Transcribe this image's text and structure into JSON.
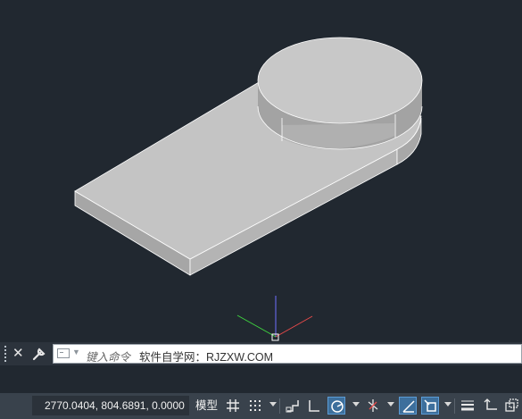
{
  "viewport": {
    "background": "#212830",
    "model": {
      "description_icon": "3d-solid-model",
      "colors": {
        "top": "#c3c3c3",
        "side_dark": "#9a9a9a",
        "side_light": "#b1b1b1",
        "edge": "#ffffff"
      }
    },
    "ucs_icon": "ucs-axes-icon"
  },
  "command_line": {
    "close_icon": "close-icon",
    "settings_icon": "wrench-icon",
    "placeholder": "键入命令",
    "text": "软件自学网：RJZXW.COM"
  },
  "status_bar": {
    "coordinates": "2770.0404, 804.6891, 0.0000",
    "model_label": "模型",
    "accent": "#5b9bd5"
  }
}
